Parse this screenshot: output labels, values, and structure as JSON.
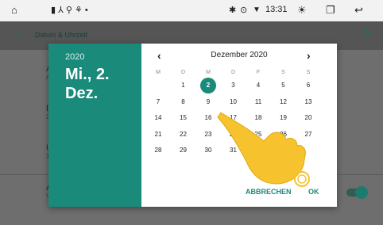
{
  "statusbar": {
    "home_icon": "home-icon",
    "time": "13:31"
  },
  "appbar": {
    "title": "Datum & Uhrzeit"
  },
  "list": {
    "rows": [
      {
        "letter": "A",
        "sub": "A"
      },
      {
        "letter": "D",
        "sub": "2"
      },
      {
        "letter": "U",
        "sub": "1"
      },
      {
        "letter": "A",
        "sub": "V"
      }
    ]
  },
  "dialog": {
    "year": "2020",
    "date": "Mi., 2. Dez.",
    "month_label": "Dezember 2020",
    "weekdays": [
      "M",
      "D",
      "M",
      "D",
      "F",
      "S",
      "S"
    ],
    "weeks": [
      [
        "",
        "1",
        "2",
        "3",
        "4",
        "5",
        "6"
      ],
      [
        "7",
        "8",
        "9",
        "10",
        "11",
        "12",
        "13"
      ],
      [
        "14",
        "15",
        "16",
        "17",
        "18",
        "19",
        "20"
      ],
      [
        "21",
        "22",
        "23",
        "24",
        "25",
        "26",
        "27"
      ],
      [
        "28",
        "29",
        "30",
        "31",
        "",
        "",
        ""
      ]
    ],
    "selected_day": "2",
    "cancel_label": "ABBRECHEN",
    "ok_label": "OK"
  },
  "colors": {
    "accent": "#1a8a7a"
  }
}
